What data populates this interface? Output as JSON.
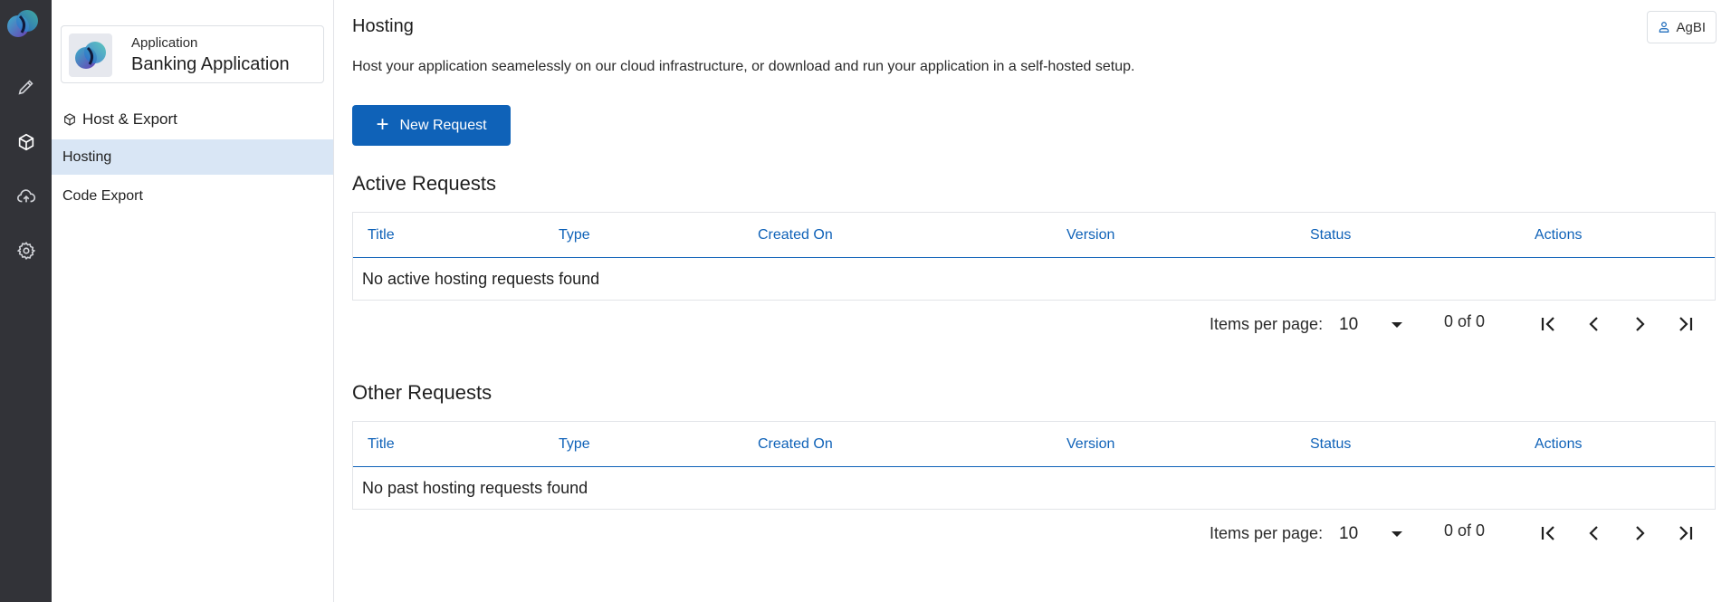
{
  "rail": {
    "items": [
      {
        "icon": "pencil-icon"
      },
      {
        "icon": "cube-icon"
      },
      {
        "icon": "cloud-upload-icon"
      },
      {
        "icon": "gear-icon"
      }
    ]
  },
  "app": {
    "kicker": "Application",
    "name": "Banking Application"
  },
  "sidebar": {
    "section": "Host & Export",
    "items": [
      {
        "label": "Hosting",
        "active": true
      },
      {
        "label": "Code Export",
        "active": false
      }
    ]
  },
  "header": {
    "title": "Hosting",
    "user": "AgBI",
    "description": "Host your application seamelessly on our cloud infrastructure, or download and run your application in a self-hosted setup."
  },
  "actions": {
    "new_request": "New Request"
  },
  "columns": [
    "Title",
    "Type",
    "Created On",
    "Version",
    "Status",
    "Actions"
  ],
  "active": {
    "title": "Active Requests",
    "empty": "No active hosting requests found",
    "items_per_page_label": "Items per page:",
    "items_per_page": "10",
    "range": "0 of 0"
  },
  "other": {
    "title": "Other Requests",
    "empty": "No past hosting requests found",
    "items_per_page_label": "Items per page:",
    "items_per_page": "10",
    "range": "0 of 0"
  },
  "colors": {
    "accent": "#0f62b8",
    "rail": "#323338",
    "active_nav": "#d9e6f5"
  }
}
